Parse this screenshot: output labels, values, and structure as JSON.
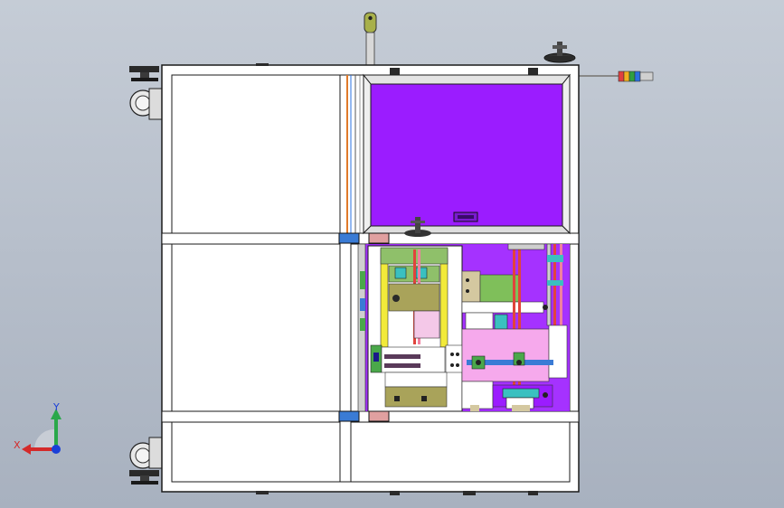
{
  "viewport": {
    "background_top": "#c5ccd6",
    "background_bottom": "#a8b1bf"
  },
  "model": {
    "description_visible": false,
    "frame_color": "#ffffff",
    "outline_color": "#1a1a1a",
    "panel_color": "#9b1cff",
    "accent_pink": "#f08de0",
    "accent_green": "#7fbf5a",
    "accent_yellow": "#f2ea3a",
    "accent_red": "#e0443c",
    "accent_blue": "#3a7bd5",
    "accent_orange": "#e07a2a"
  },
  "triad": {
    "x_label": "X",
    "y_label": "Y",
    "x_color": "#d42a2a",
    "y_color": "#2aa84a",
    "z_color": "#1a3fd8"
  },
  "signal_tower": {
    "segments": [
      "#e04040",
      "#f0b020",
      "#30a040",
      "#2a70e0"
    ]
  }
}
